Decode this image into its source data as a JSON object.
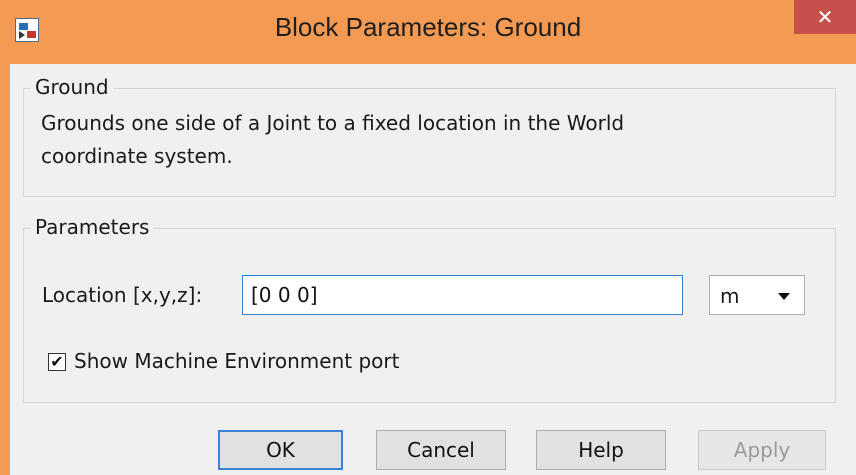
{
  "window": {
    "title": "Block Parameters: Ground",
    "close_glyph": "✕",
    "frame_color": "#f49a52",
    "close_color": "#c7504a"
  },
  "group_ground": {
    "title": "Ground",
    "description_line1": "Grounds one side of a Joint to a fixed location in the World",
    "description_line2": "coordinate system."
  },
  "group_parameters": {
    "title": "Parameters",
    "location_label": "Location [x,y,z]:",
    "location_value": "[0 0 0]",
    "unit_value": "m",
    "checkbox_checked": true,
    "checkbox_label": "Show Machine Environment port"
  },
  "buttons": {
    "ok": "OK",
    "cancel": "Cancel",
    "help": "Help",
    "apply": "Apply"
  }
}
